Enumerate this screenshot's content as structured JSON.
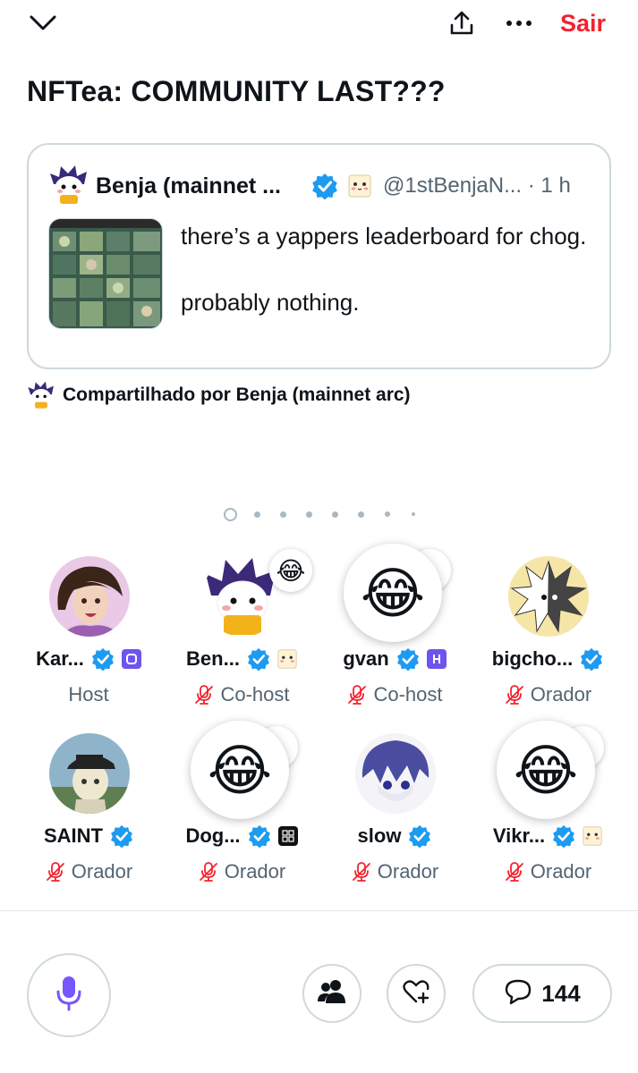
{
  "header": {
    "close_icon": "chevron-down-icon",
    "share_icon": "share-icon",
    "more_icon": "more-icon",
    "exit_label": "Sair"
  },
  "space": {
    "title": "NFTea: COMMUNITY LAST???"
  },
  "quoted_tweet": {
    "author_name": "Benja (mainnet ...",
    "handle": "@1stBenjaN... · 1 h",
    "text_lines": [
      "there’s a yappers leaderboard for chog.",
      "probably nothing."
    ]
  },
  "shared_by": "Compartilhado por Benja (mainnet arc)",
  "pagination": {
    "count": 8,
    "active": 0
  },
  "speakers": [
    {
      "name": "Kar...",
      "role": "Host",
      "muted": false,
      "badge": "square-logo",
      "reaction": ""
    },
    {
      "name": "Ben...",
      "role": "Co-host",
      "muted": true,
      "badge": "emoji-badge",
      "reaction": "😂"
    },
    {
      "name": "gvan",
      "role": "Co-host",
      "muted": true,
      "badge": "h-logo",
      "reaction": "😂"
    },
    {
      "name": "bigcho...",
      "role": "Orador",
      "muted": true,
      "badge": "",
      "reaction": ""
    },
    {
      "name": "SAINT",
      "role": "Orador",
      "muted": true,
      "badge": "",
      "reaction": ""
    },
    {
      "name": "Dog...",
      "role": "Orador",
      "muted": true,
      "badge": "cube-logo",
      "reaction": "😂"
    },
    {
      "name": "slow",
      "role": "Orador",
      "muted": true,
      "badge": "",
      "reaction": ""
    },
    {
      "name": "Vikr...",
      "role": "Orador",
      "muted": true,
      "badge": "emoji-badge",
      "reaction": "😂"
    }
  ],
  "footer": {
    "mic_icon": "microphone-icon",
    "people_icon": "people-icon",
    "heart_icon": "heart-plus-icon",
    "comment_count": "144"
  },
  "colors": {
    "exit": "#f4212e",
    "verified": "#1d9bf0",
    "mic": "#7856ff",
    "muted": "#f4212e"
  }
}
